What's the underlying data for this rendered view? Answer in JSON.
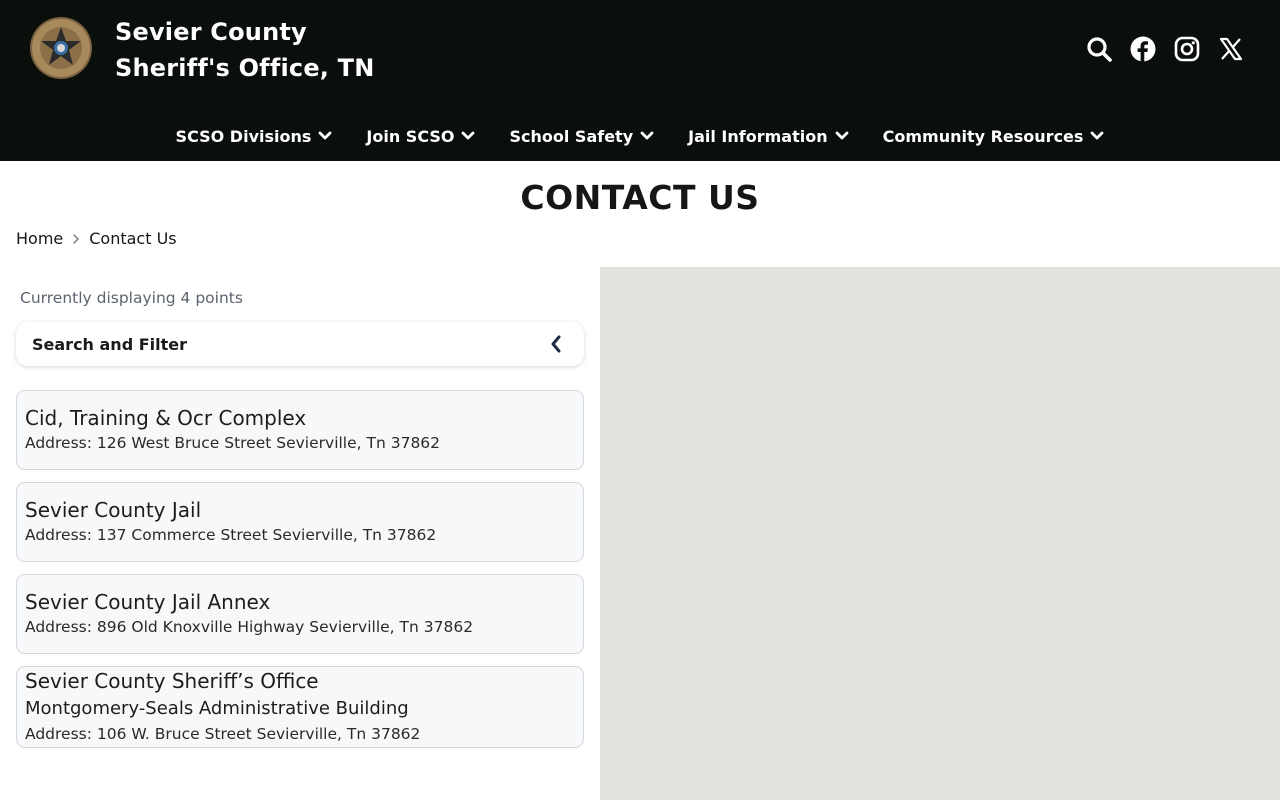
{
  "header": {
    "title_line1": "Sevier County",
    "title_line2": "Sheriff's Office, TN",
    "logo_icon": "sheriff-star-badge-icon",
    "icons": [
      "search-icon",
      "facebook-icon",
      "instagram-icon",
      "x-twitter-icon"
    ]
  },
  "nav": {
    "items": [
      {
        "label": "SCSO Divisions"
      },
      {
        "label": "Join SCSO"
      },
      {
        "label": "School Safety"
      },
      {
        "label": "Jail Information"
      },
      {
        "label": "Community Resources"
      }
    ]
  },
  "page": {
    "title": "CONTACT US"
  },
  "breadcrumb": {
    "home": "Home",
    "current": "Contact Us"
  },
  "panel": {
    "display_count": "Currently displaying 4 points",
    "search_filter_label": "Search and Filter"
  },
  "locations": [
    {
      "name": "Cid, Training & Ocr Complex",
      "address": "Address: 126 West Bruce Street Sevierville, Tn 37862"
    },
    {
      "name": "Sevier County Jail",
      "address": "Address: 137 Commerce Street Sevierville, Tn 37862"
    },
    {
      "name": "Sevier County Jail Annex",
      "address": "Address: 896 Old Knoxville Highway Sevierville, Tn 37862"
    },
    {
      "name": "Sevier County Sheriff’s Office",
      "name_line2": "Montgomery-Seals Administrative Building",
      "address": "Address: 106 W. Bruce Street Sevierville, Tn 37862"
    }
  ],
  "colors": {
    "header_bg": "#0b0f0c",
    "map_bg": "#e4e2de",
    "card_bg": "#f7f8fa",
    "badge_gold": "#9a7b4f"
  }
}
